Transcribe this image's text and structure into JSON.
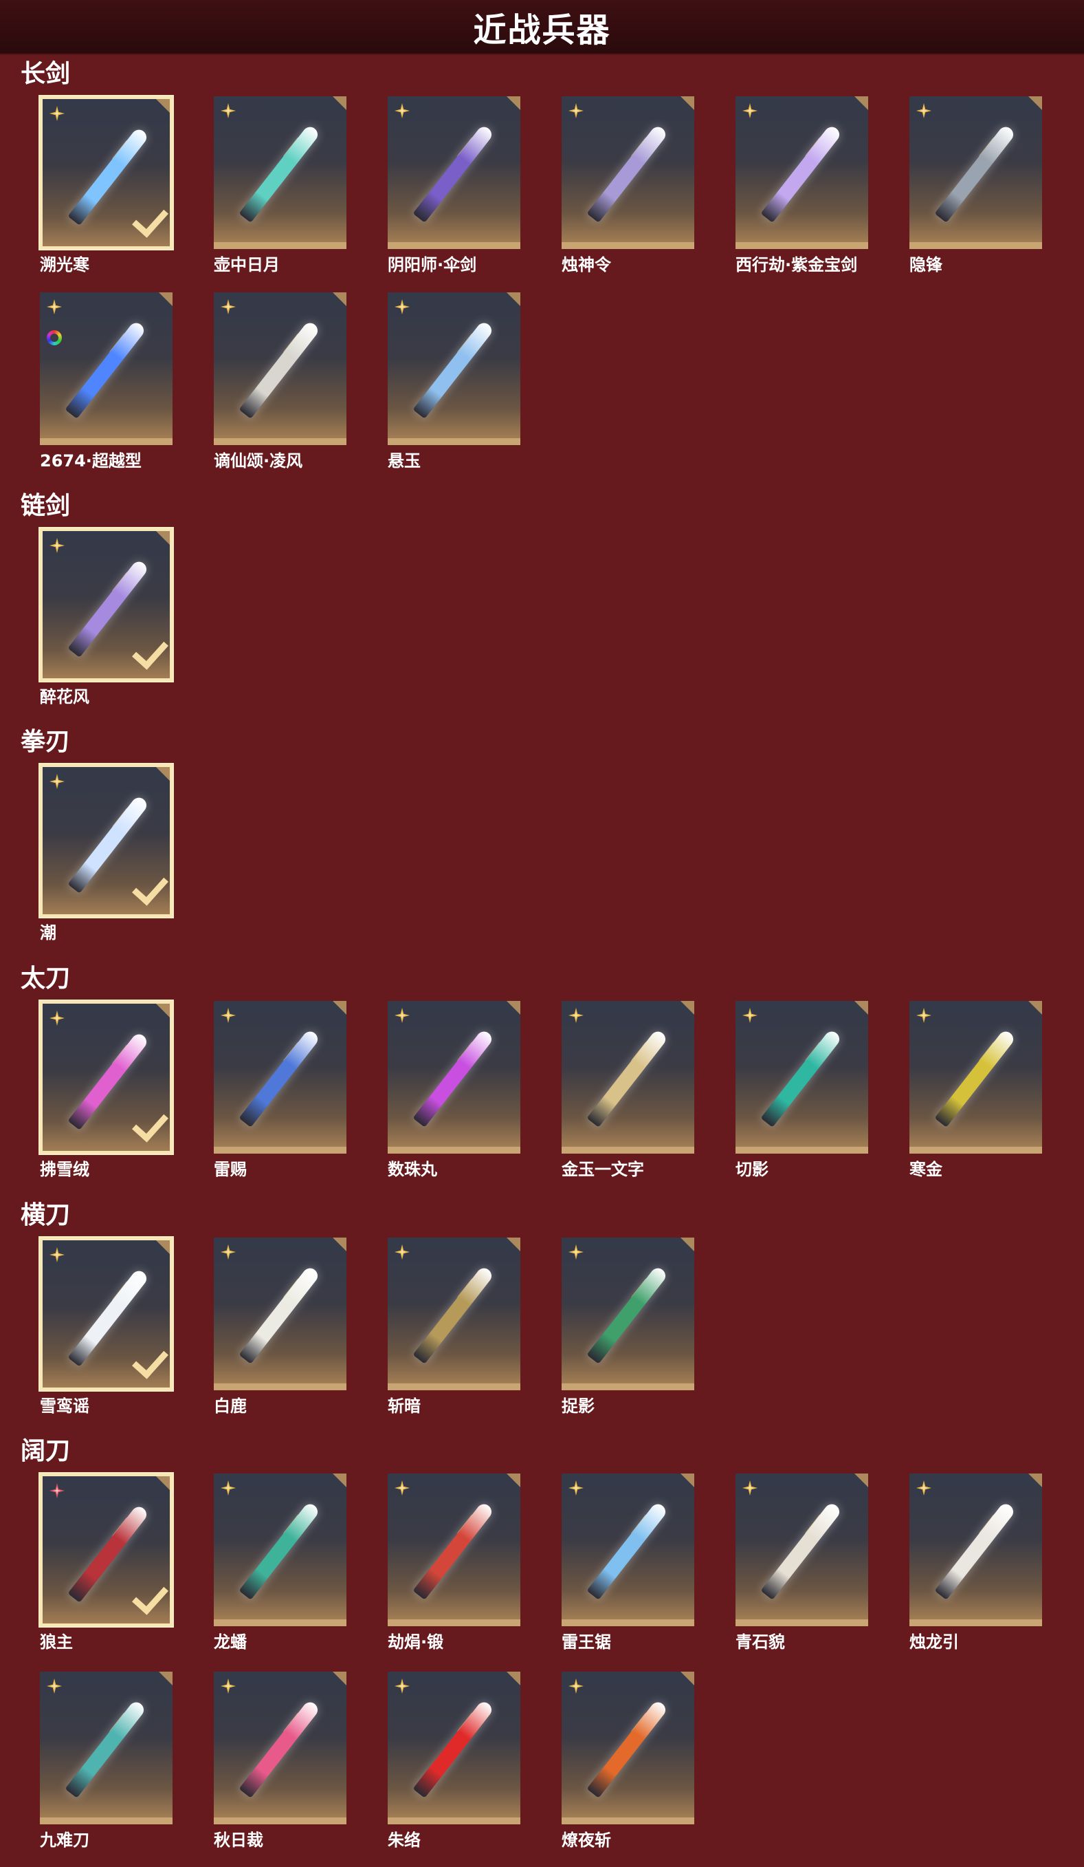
{
  "title": "近战兵器",
  "colors": {
    "background": "#661a1e",
    "header": "#2a0a0c",
    "selected_border": "#f7e7b6",
    "rarity_gold": "#e8b84a",
    "rarity_red": "#e0546a"
  },
  "categories": [
    {
      "name": "长剑",
      "items": [
        {
          "name": "溯光寒",
          "selected": true,
          "rarity": "gold",
          "color": "#7fc4ff"
        },
        {
          "name": "壶中日月",
          "selected": false,
          "rarity": "gold",
          "color": "#5fd0c2"
        },
        {
          "name": "阴阳师·伞剑",
          "selected": false,
          "rarity": "gold",
          "color": "#7a5fc9"
        },
        {
          "name": "烛神令",
          "selected": false,
          "rarity": "gold",
          "color": "#a79ad6"
        },
        {
          "name": "西行劫·紫金宝剑",
          "selected": false,
          "rarity": "gold",
          "color": "#c3a8f0"
        },
        {
          "name": "隐锋",
          "selected": false,
          "rarity": "gold",
          "color": "#9aa4b0"
        },
        {
          "name": "2674·超越型",
          "selected": false,
          "rarity": "gold",
          "color": "#4f86ff",
          "chroma": true
        },
        {
          "name": "谪仙颂·凌风",
          "selected": false,
          "rarity": "gold",
          "color": "#d8d6cf"
        },
        {
          "name": "悬玉",
          "selected": false,
          "rarity": "gold",
          "color": "#8fc0ef"
        }
      ]
    },
    {
      "name": "链剑",
      "items": [
        {
          "name": "醉花风",
          "selected": true,
          "rarity": "gold",
          "color": "#a58ae0"
        }
      ]
    },
    {
      "name": "拳刃",
      "items": [
        {
          "name": "潮",
          "selected": true,
          "rarity": "gold",
          "color": "#cfe2ff"
        }
      ]
    },
    {
      "name": "太刀",
      "items": [
        {
          "name": "拂雪绒",
          "selected": true,
          "rarity": "gold",
          "color": "#e060d0"
        },
        {
          "name": "雷赐",
          "selected": false,
          "rarity": "gold",
          "color": "#4f78d8"
        },
        {
          "name": "数珠丸",
          "selected": false,
          "rarity": "gold",
          "color": "#c84fe0"
        },
        {
          "name": "金玉一文字",
          "selected": false,
          "rarity": "gold",
          "color": "#d9c289"
        },
        {
          "name": "切影",
          "selected": false,
          "rarity": "gold",
          "color": "#2fb7a2"
        },
        {
          "name": "寒金",
          "selected": false,
          "rarity": "gold",
          "color": "#d6c23a"
        }
      ]
    },
    {
      "name": "横刀",
      "items": [
        {
          "name": "雪鸾谣",
          "selected": true,
          "rarity": "gold",
          "color": "#eef2f6"
        },
        {
          "name": "白鹿",
          "selected": false,
          "rarity": "gold",
          "color": "#ecebe3"
        },
        {
          "name": "斩暗",
          "selected": false,
          "rarity": "gold",
          "color": "#b69a5a"
        },
        {
          "name": "捉影",
          "selected": false,
          "rarity": "gold",
          "color": "#3fa06b"
        }
      ]
    },
    {
      "name": "阔刀",
      "items": [
        {
          "name": "狼主",
          "selected": true,
          "rarity": "red",
          "color": "#b8333a"
        },
        {
          "name": "龙蟠",
          "selected": false,
          "rarity": "gold",
          "color": "#3fb39a"
        },
        {
          "name": "劫焆·锻",
          "selected": false,
          "rarity": "gold",
          "color": "#d4463a"
        },
        {
          "name": "雷王锯",
          "selected": false,
          "rarity": "gold",
          "color": "#7fc0f0"
        },
        {
          "name": "青石貌",
          "selected": false,
          "rarity": "gold",
          "color": "#e6e0d4"
        },
        {
          "name": "烛龙引",
          "selected": false,
          "rarity": "gold",
          "color": "#eae6e0"
        },
        {
          "name": "九难刀",
          "selected": false,
          "rarity": "gold",
          "color": "#4fb3b0"
        },
        {
          "name": "秋日裁",
          "selected": false,
          "rarity": "gold",
          "color": "#e85a8a"
        },
        {
          "name": "朱络",
          "selected": false,
          "rarity": "gold",
          "color": "#e02a2a"
        },
        {
          "name": "燎夜斩",
          "selected": false,
          "rarity": "gold",
          "color": "#e36a2a"
        }
      ]
    }
  ]
}
